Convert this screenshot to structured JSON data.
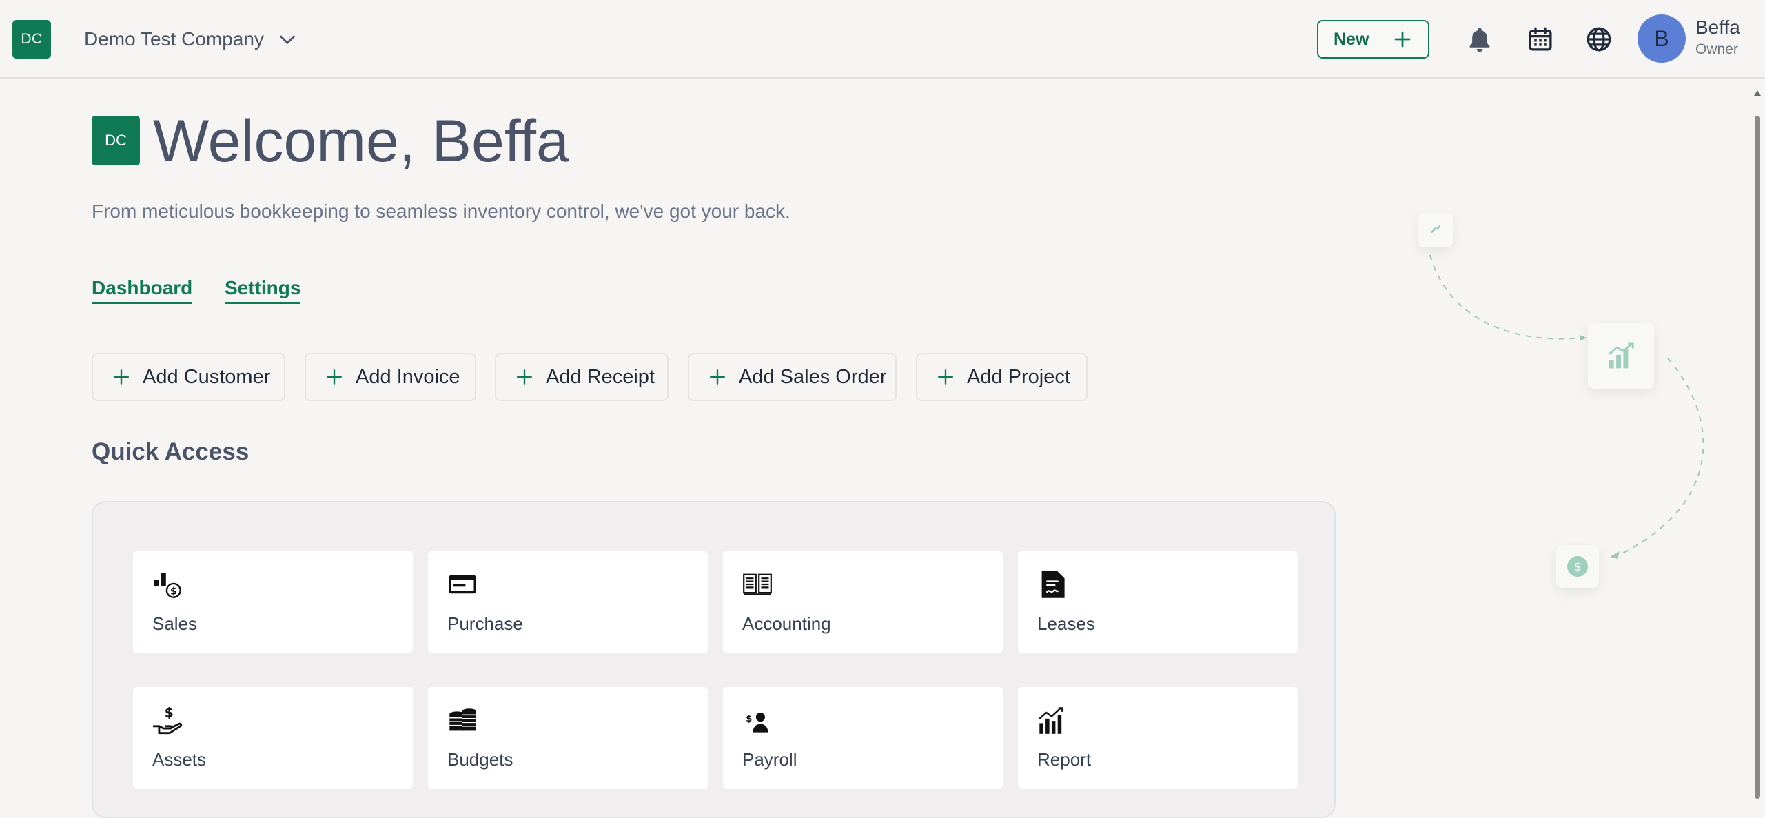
{
  "header": {
    "logo_text": "DC",
    "company_name": "Demo Test Company",
    "new_button_label": "New",
    "user": {
      "avatar_initial": "B",
      "name": "Beffa",
      "role": "Owner"
    },
    "icons": [
      "bell-icon",
      "calendar-icon",
      "globe-icon"
    ]
  },
  "main": {
    "logo_text": "DC",
    "welcome_title": "Welcome, Beffa",
    "subtitle": "From meticulous bookkeeping to seamless inventory control, we've got your back.",
    "tabs": [
      {
        "label": "Dashboard"
      },
      {
        "label": "Settings"
      }
    ],
    "quick_buttons": [
      {
        "label": "Add Customer"
      },
      {
        "label": "Add Invoice"
      },
      {
        "label": "Add Receipt"
      },
      {
        "label": "Add Sales Order"
      },
      {
        "label": "Add Project"
      }
    ],
    "quick_access_title": "Quick Access",
    "cards": [
      {
        "label": "Sales",
        "icon": "sales-icon"
      },
      {
        "label": "Purchase",
        "icon": "credit-card-icon"
      },
      {
        "label": "Accounting",
        "icon": "ledger-book-icon"
      },
      {
        "label": "Leases",
        "icon": "document-icon"
      },
      {
        "label": "Assets",
        "icon": "hand-dollar-icon"
      },
      {
        "label": "Budgets",
        "icon": "coin-stack-icon"
      },
      {
        "label": "Payroll",
        "icon": "person-pay-icon"
      },
      {
        "label": "Report",
        "icon": "bar-chart-icon"
      }
    ]
  },
  "colors": {
    "brand_green": "#0f7a55",
    "avatar_blue": "#5c7fd6",
    "background": "#f6f5f4",
    "heading": "#4a5368"
  }
}
